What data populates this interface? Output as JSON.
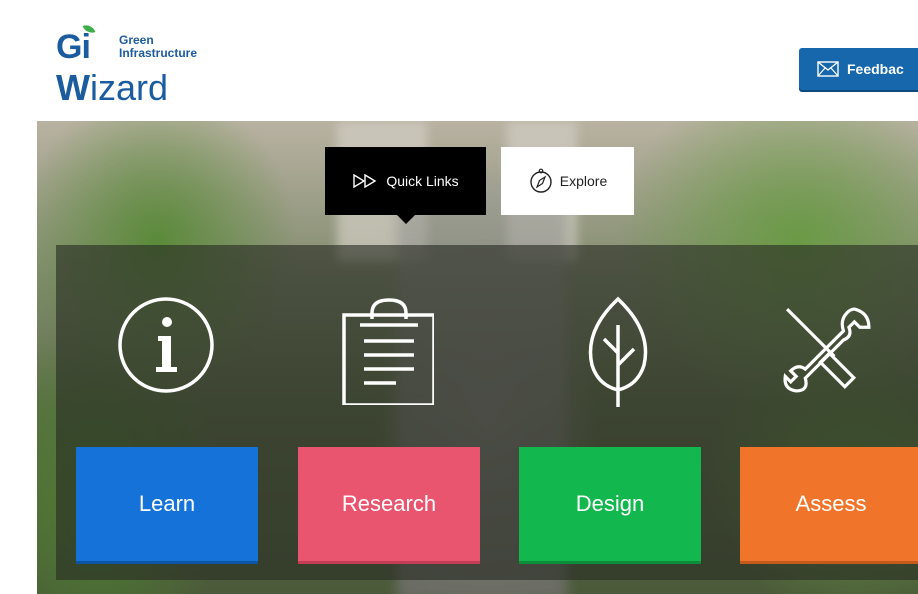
{
  "header": {
    "logo": {
      "gi": "Gi",
      "line1": "Green",
      "line2": "Infrastructure",
      "wizard_w": "W",
      "wizard_rest": "izard"
    },
    "feedback_label": "Feedbac"
  },
  "tabs": [
    {
      "label": "Quick Links",
      "icon": "fast-forward-icon",
      "active": true
    },
    {
      "label": "Explore",
      "icon": "compass-icon",
      "active": false
    }
  ],
  "categories": [
    {
      "label": "Learn",
      "icon": "info-icon",
      "color": "#1472d8"
    },
    {
      "label": "Research",
      "icon": "clipboard-icon",
      "color": "#e9546f"
    },
    {
      "label": "Design",
      "icon": "leaf-icon",
      "color": "#12b74e"
    },
    {
      "label": "Assess",
      "icon": "tools-icon",
      "color": "#f0752b"
    }
  ]
}
